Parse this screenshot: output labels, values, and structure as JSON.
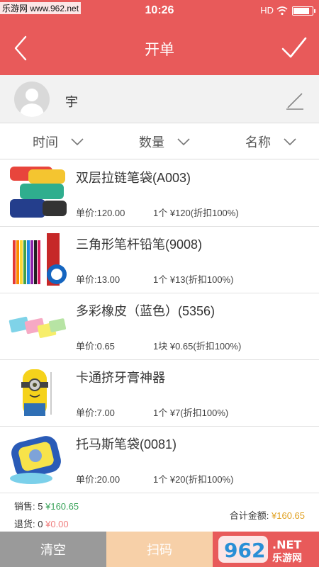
{
  "status_bar": {
    "watermark": "乐游网 www.962.net",
    "time": "10:26",
    "network": "HD",
    "icons": [
      "wifi-icon",
      "battery-icon"
    ]
  },
  "header": {
    "title": "开单",
    "back_icon": "chevron-left-icon",
    "confirm_icon": "checkmark-icon"
  },
  "customer": {
    "name": "宇",
    "avatar_icon": "user-avatar-icon",
    "edit_icon": "pencil-icon"
  },
  "sort_options": [
    {
      "label": "时间",
      "icon": "chevron-down-icon"
    },
    {
      "label": "数量",
      "icon": "chevron-down-icon"
    },
    {
      "label": "名称",
      "icon": "chevron-down-icon"
    }
  ],
  "products": [
    {
      "name": "双层拉链笔袋(A003)",
      "price": "单价:120.00",
      "qty": "1个 ¥120(折扣100%)"
    },
    {
      "name": "三角形笔杆铅笔(9008)",
      "price": "单价:13.00",
      "qty": "1个 ¥13(折扣100%)"
    },
    {
      "name": "多彩橡皮（蓝色）(5356)",
      "price": "单价:0.65",
      "qty": "1块 ¥0.65(折扣100%)"
    },
    {
      "name": "卡通挤牙膏神器",
      "price": "单价:7.00",
      "qty": "1个 ¥7(折扣100%)"
    },
    {
      "name": "托马斯笔袋(0081)",
      "price": "单价:20.00",
      "qty": "1个 ¥20(折扣100%)"
    }
  ],
  "summary": {
    "sales_label": "销售:",
    "sales_count": "5",
    "sales_amount": "¥160.65",
    "returns_label": "退货:",
    "returns_count": "0",
    "returns_amount": "¥0.00",
    "total_label": "合计金额:",
    "total_amount": "¥160.65"
  },
  "buttons": {
    "clear": "清空",
    "scan": "扫码"
  },
  "colors": {
    "accent": "#e85a5a",
    "sales_green": "#3aa35a",
    "returns_pink": "#f08080",
    "total_gold": "#e0a020"
  }
}
